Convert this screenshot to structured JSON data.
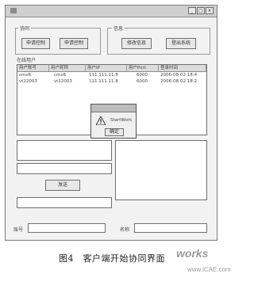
{
  "window": {
    "title": "",
    "minimize_label": "_",
    "maximize_label": "□",
    "close_label": "×"
  },
  "group_left": {
    "label": "协同",
    "buttons": [
      "申请控制",
      "申请控制"
    ]
  },
  "group_right": {
    "label": "信息",
    "buttons": [
      "修改信息",
      "登出系统"
    ]
  },
  "online_list": {
    "label": "在线用户",
    "columns": [
      "用户账号",
      "用户昵称",
      "用户IP",
      "用户Port",
      "登录时间"
    ],
    "rows": [
      [
        "cmx6",
        "cmx6",
        "111.111.11.8",
        "6000",
        "2006-08-02 18:4"
      ],
      [
        "vt12003",
        "vt12003",
        "111.111.11.8",
        "6000",
        "2006-08-02 18:2"
      ]
    ]
  },
  "send_button": "发送",
  "bottom": {
    "account_label": "账号",
    "name_label": "名称"
  },
  "dialog": {
    "title": "",
    "message": "StartWork",
    "ok_label": "确定"
  },
  "caption": "图4　客户端开始协同界面",
  "watermark": {
    "logo": "works",
    "site": "www.iCAE.com"
  },
  "colors": {
    "window_bg": "#f2f2f2",
    "title_bar": "#cfcfcf",
    "border": "#7a7a7a"
  }
}
